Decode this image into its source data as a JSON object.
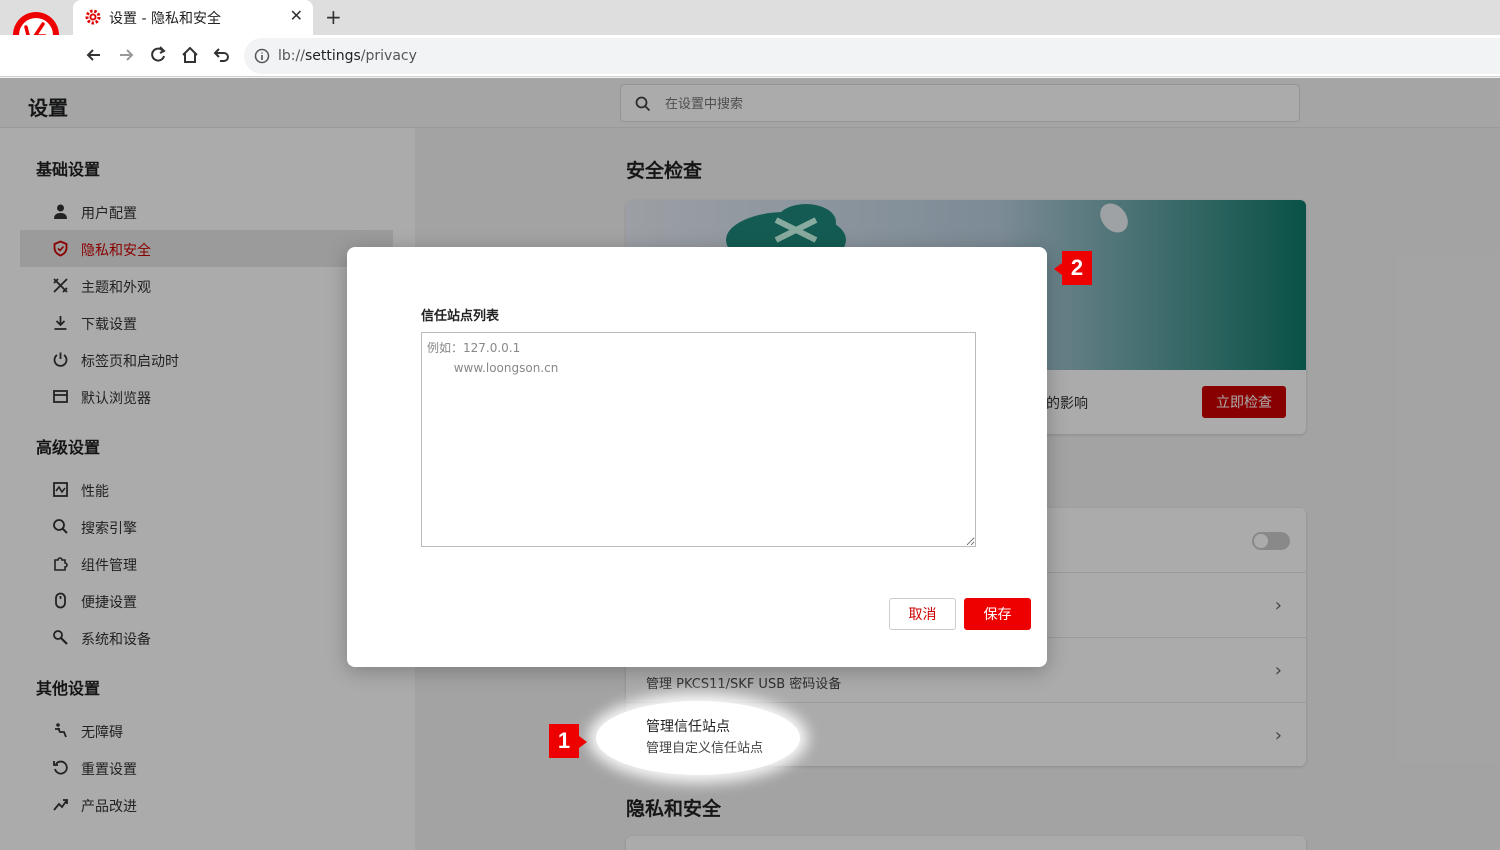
{
  "browser": {
    "tab_title": "设置 - 隐私和安全",
    "url_prefix": "lb://",
    "url_path": "settings",
    "url_suffix": "/privacy",
    "brand_color": "#e00000"
  },
  "header": {
    "title": "设置",
    "search_placeholder": "在设置中搜索"
  },
  "sidebar": {
    "groups": [
      {
        "title": "基础设置",
        "items": [
          {
            "label": "用户配置",
            "icon": "user-icon"
          },
          {
            "label": "隐私和安全",
            "icon": "shield-icon",
            "active": true
          },
          {
            "label": "主题和外观",
            "icon": "brush-icon"
          },
          {
            "label": "下载设置",
            "icon": "download-icon"
          },
          {
            "label": "标签页和启动时",
            "icon": "power-icon"
          },
          {
            "label": "默认浏览器",
            "icon": "browser-icon"
          }
        ]
      },
      {
        "title": "高级设置",
        "items": [
          {
            "label": "性能",
            "icon": "performance-icon"
          },
          {
            "label": "搜索引擎",
            "icon": "search-icon"
          },
          {
            "label": "组件管理",
            "icon": "puzzle-icon"
          },
          {
            "label": "便捷设置",
            "icon": "mouse-icon"
          },
          {
            "label": "系统和设备",
            "icon": "wrench-icon"
          }
        ]
      },
      {
        "title": "其他设置",
        "items": [
          {
            "label": "无障碍",
            "icon": "accessibility-icon"
          },
          {
            "label": "重置设置",
            "icon": "reset-icon"
          },
          {
            "label": "产品改进",
            "icon": "trend-icon"
          }
        ]
      }
    ]
  },
  "main": {
    "safety_check_title": "安全检查",
    "safety_check_desc": "的影响",
    "check_now_label": "立即检查",
    "usb_device_desc": "管理 PKCS11/SKF USB 密码设备",
    "trusted_sites_title": "管理信任站点",
    "trusted_sites_desc": "管理自定义信任站点",
    "privacy_section_title": "隐私和安全"
  },
  "dialog": {
    "label": "信任站点列表",
    "placeholder": "例如：127.0.0.1\n       www.loongson.cn",
    "cancel_label": "取消",
    "save_label": "保存"
  },
  "annotations": {
    "marker_1": "1",
    "marker_2": "2"
  }
}
